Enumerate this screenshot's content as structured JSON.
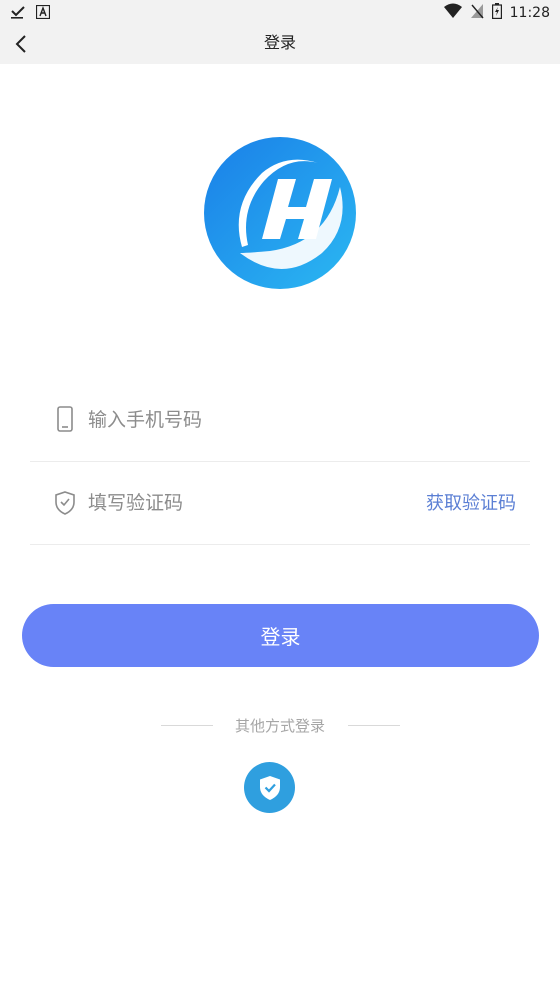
{
  "status_bar": {
    "time": "11:28",
    "left_icons": [
      "check-icon",
      "a-app-icon"
    ],
    "right_icons": [
      "wifi-icon",
      "no-signal-icon",
      "battery-charging-icon"
    ]
  },
  "header": {
    "title": "登录",
    "back_icon": "chevron-left-icon"
  },
  "logo": {
    "icon": "app-logo-h"
  },
  "form": {
    "phone": {
      "placeholder": "输入手机号码",
      "value": "",
      "icon": "phone-icon"
    },
    "code": {
      "placeholder": "填写验证码",
      "value": "",
      "icon": "shield-icon",
      "get_code_label": "获取验证码"
    },
    "login_label": "登录"
  },
  "other_login": {
    "label": "其他方式登录",
    "option_icon": "shield-check-icon"
  },
  "colors": {
    "primary": "#6883f7",
    "link": "#5b7fd4",
    "alt_login": "#2f9fdf",
    "bar_background": "#f2f2f2"
  }
}
